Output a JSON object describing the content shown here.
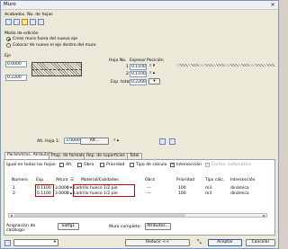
{
  "window": {
    "title": "Muro",
    "close": "×"
  },
  "acabados": {
    "label": "Acabados. No. de hojas"
  },
  "edit_mode": {
    "label": "Modo de edición",
    "options": [
      "Crear muro fuera del nuevo eje",
      "Colocar de nuevo el eje dentro del muro"
    ]
  },
  "eje": {
    "label": "Eje",
    "offsets": [
      "0.0000",
      "0.2200"
    ],
    "headers": {
      "hoja": "Hoja No.",
      "espesor": "Espesor",
      "posicion": "Posición"
    },
    "rows": [
      {
        "n": "1",
        "espesor": "0.1100"
      },
      {
        "n": "2",
        "espesor": "0.1100"
      }
    ],
    "total_label": "Esp. total:",
    "total_value": "0.2200"
  },
  "alt_hoja": {
    "label": "Alt. Hoja 1:",
    "value": "3.0000",
    "button": "Alt..."
  },
  "tabs": [
    "Parámetros, Atributo",
    "Prop. de formato",
    "Rep. de superficies",
    "Total"
  ],
  "filters": {
    "label": "igual en todas las hojas:",
    "items": [
      "Alt.",
      "Obra",
      "Prioridad",
      "Tipo de cálculo",
      "Intersección",
      "Cortes: automática"
    ],
    "checked": [
      false,
      false,
      false,
      false,
      true,
      true
    ]
  },
  "table": {
    "headers": [
      "Número",
      "Esp.",
      "Altura",
      "Material/Calidades",
      "Obra",
      "Prioridad",
      "Tipo cálc.",
      "Intersección"
    ],
    "rows": [
      [
        "1",
        "0.1100",
        "3.0000",
        "Ladrillo hueco 1/2 pie",
        "---",
        "100",
        "m3",
        "dinámica"
      ],
      [
        "2",
        "0.1100",
        "3.0000",
        "Ladrillo hueco 1/2 pie",
        "---",
        "100",
        "m3",
        "dinámica"
      ]
    ]
  },
  "bottom": {
    "asignacion": "Asignación de catálogo:",
    "katfg_button": "katfg1",
    "muro_completo": "Muro completo:",
    "atributos_button": "Atributos..."
  },
  "footer": {
    "reducir": "Reducir <<",
    "aceptar": "Aceptar",
    "cancelar": "Cancelar"
  }
}
